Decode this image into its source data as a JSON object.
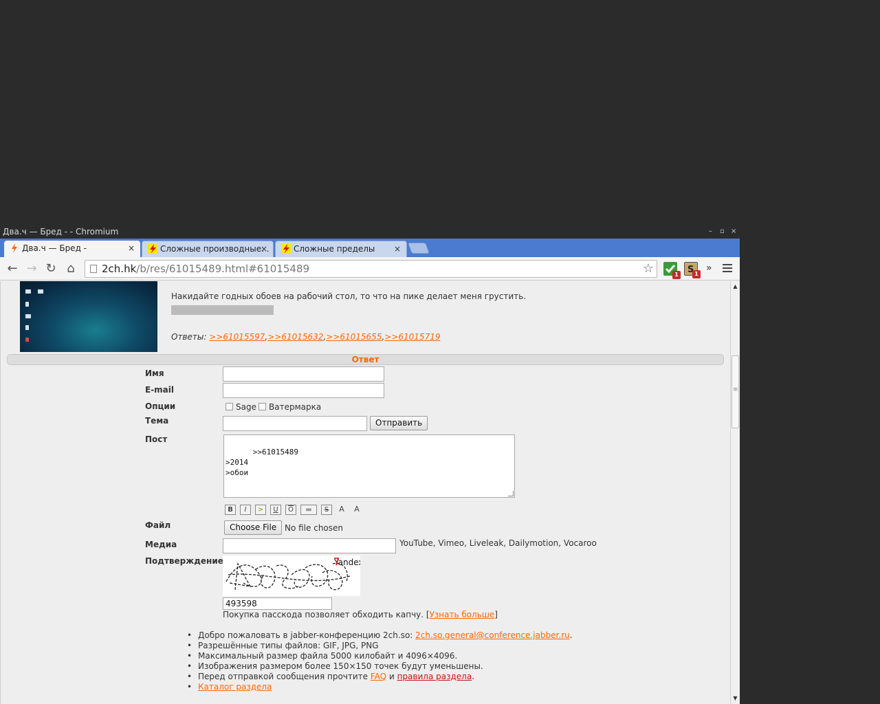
{
  "window": {
    "title": "Два.ч — Бред - - Chromium",
    "controls": {
      "minimize": "–",
      "maximize": "▫",
      "close": "×"
    }
  },
  "tabs": [
    {
      "label": "Два.ч — Бред -",
      "active": true
    },
    {
      "label": "Сложные производные. .",
      "active": false
    },
    {
      "label": "Сложные пределы",
      "active": false
    }
  ],
  "tab_close": "×",
  "address": {
    "host": "2ch.hk",
    "path": "/b/res/61015489.html#61015489"
  },
  "extensions": [
    {
      "badge": "1"
    },
    {
      "badge": "1"
    }
  ],
  "overflow_chevron": "»",
  "post": {
    "text": "Накидайте годных обоев на рабочий стол, то что на пике делает меня грустить.",
    "replies_label": "Ответы:",
    "replies": [
      ">>61015597",
      ">>61015632",
      ">>61015655",
      ">>61015719"
    ],
    "reply_separator": ","
  },
  "form": {
    "header": "Ответ",
    "name_label": "Имя",
    "email_label": "E-mail",
    "options_label": "Опции",
    "sage_label": "Sage",
    "watermark_label": "Ватермарка",
    "subject_label": "Тема",
    "submit_label": "Отправить",
    "post_label": "Пост",
    "post_value": ">>61015489\n>2014\n>обои",
    "file_label": "Файл",
    "choose_file_label": "Choose File",
    "no_file_text": "No file chosen",
    "media_label": "Медиа",
    "media_hint": "YouTube, Vimeo, Liveleak, Dailymotion, Vocaroo",
    "captcha_label": "Подтверждение",
    "captcha_logo": "Yandex",
    "captcha_value": "493598",
    "passcode_text": "Покупка пасскода позволяет обходить капчу.",
    "passcode_link": "Узнать больше",
    "format_buttons": [
      "B",
      "I",
      ">",
      "U",
      "O",
      "▬",
      "S",
      "A",
      "A"
    ]
  },
  "rules": {
    "jabber_prefix": "Добро пожаловать в jabber-конференцию 2ch.so:",
    "jabber_link": "2ch.so.general@conference.jabber.ru",
    "filetypes": "Разрешённые типы файлов: GIF, JPG, PNG",
    "maxsize": "Максимальный размер файла 5000 килобайт и 4096×4096.",
    "shrink": "Изображения размером более 150×150 точек будут уменьшены.",
    "faq_prefix": "Перед отправкой сообщения прочтите",
    "faq_link": "FAQ",
    "faq_and": "и",
    "rules_link": "правила раздела",
    "catalog_link": "Каталог раздела"
  },
  "colors": {
    "accent": "#ff6600",
    "tabstrip": "#4a7bd0",
    "page_bg": "#eeeeee"
  }
}
